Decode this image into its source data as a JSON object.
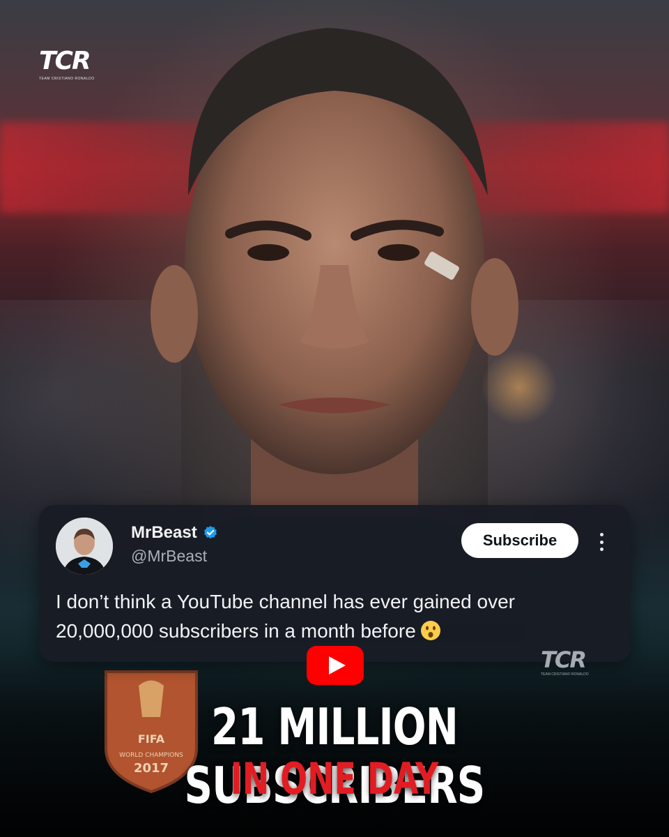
{
  "branding": {
    "logo_mark": "TCR",
    "logo_tagline": "TEAM CRISTIANO RONALDO",
    "watermark_mark": "TCR",
    "watermark_tagline": "TEAM CRISTIANO RONALDO"
  },
  "tweet": {
    "author_name": "MrBeast",
    "verified": true,
    "handle": "@MrBeast",
    "subscribe_label": "Subscribe",
    "text_line_1": "I don’t think a YouTube channel has ever gained over",
    "text_line_2": "20,000,000 subscribers in a month before",
    "emoji": "face-with-open-mouth"
  },
  "jersey_badge": {
    "label_top": "FIFA",
    "label_mid": "WORLD CHAMPIONS",
    "year": "2017"
  },
  "headline": {
    "main": "21 MILLION  SUBSCRIBERS",
    "sub": "IN ONE DAY"
  },
  "colors": {
    "headline_main": "#ffffff",
    "headline_sub": "#e11d23",
    "youtube_red": "#ff0000",
    "verified_blue": "#1d9bf0",
    "card_bg": "#181c24"
  }
}
